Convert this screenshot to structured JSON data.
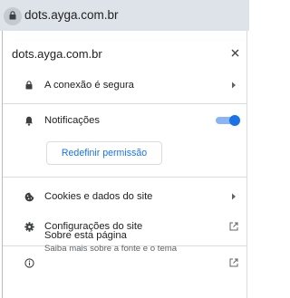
{
  "address_bar": {
    "url": "dots.ayga.com.br"
  },
  "popup": {
    "title": "dots.ayga.com.br",
    "connection": {
      "label": "A conexão é segura"
    },
    "notifications": {
      "label": "Notificações",
      "enabled": true
    },
    "reset_permission": {
      "label": "Redefinir permissão"
    },
    "cookies": {
      "label": "Cookies e dados do site"
    },
    "site_settings": {
      "label": "Configurações do site"
    },
    "about": {
      "title": "Sobre esta página",
      "subtitle": "Saiba mais sobre a fonte e o tema"
    }
  },
  "colors": {
    "accent": "#1a73e8",
    "toggle_track": "#8ab4f8",
    "address_bar_bg": "#dee3ea"
  }
}
